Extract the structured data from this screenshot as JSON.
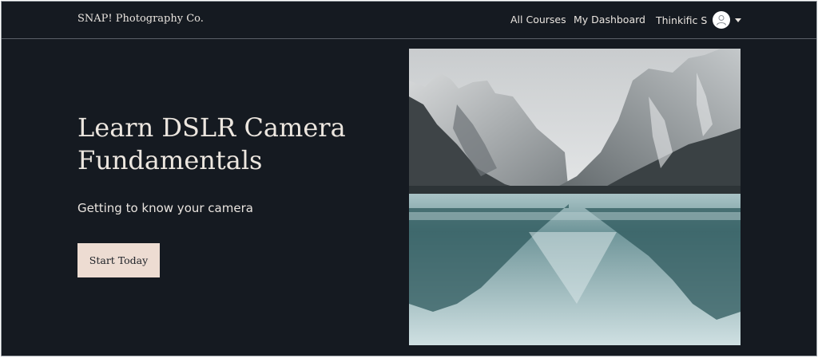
{
  "header": {
    "brand": "SNAP! Photography Co.",
    "nav": {
      "all_courses": "All Courses",
      "my_dashboard": "My Dashboard"
    },
    "user": {
      "name": "Thinkific S",
      "avatar_icon": "user-avatar-icon",
      "menu_icon": "caret-down-icon"
    }
  },
  "hero": {
    "title": "Learn DSLR Camera Fundamentals",
    "subtitle": "Getting to know your camera",
    "cta_label": "Start Today",
    "image": "snowy-mountain-lake-photo"
  },
  "colors": {
    "background": "#151a21",
    "text": "#e9e4df",
    "button_bg": "#eddcd2",
    "button_text": "#1b1f25"
  }
}
